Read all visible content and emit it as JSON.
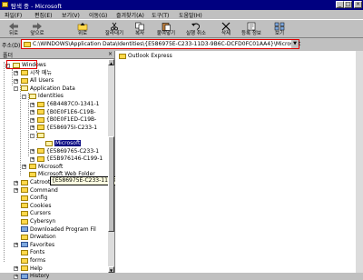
{
  "window": {
    "title": "탐색 중 - Microsoft",
    "buttons": {
      "minimize": "_",
      "maximize": "□",
      "close": "×"
    }
  },
  "menu": [
    "파일(F)",
    "편집(E)",
    "보기(V)",
    "이동(G)",
    "즐겨찾기(A)",
    "도구(T)",
    "도움말(H)"
  ],
  "toolbar": [
    {
      "label": "뒤로",
      "icon": "back-arrow-icon"
    },
    {
      "label": "앞으로",
      "icon": "forward-arrow-icon"
    },
    {
      "label": "위로",
      "icon": "up-folder-icon"
    },
    {
      "label": "잘라내기",
      "icon": "scissors-icon"
    },
    {
      "label": "복사",
      "icon": "copy-icon"
    },
    {
      "label": "붙여넣기",
      "icon": "paste-icon"
    },
    {
      "label": "실행 취소",
      "icon": "undo-icon"
    },
    {
      "label": "삭제",
      "icon": "delete-icon"
    },
    {
      "label": "등록 정보",
      "icon": "properties-icon"
    },
    {
      "label": "보기",
      "icon": "views-icon"
    }
  ],
  "address": {
    "label": "주소(D)",
    "value": "C:\\WINDOWS\\Application Data\\Identities\\{E586975E-C233-11D3-9B6C-DCFD0FC01AA4}\\Microsoft"
  },
  "tree": {
    "header": "폴더",
    "close": "×",
    "nodes": [
      {
        "label": "Windows",
        "level": 1,
        "pm": "-",
        "icon": "folder-open-icon",
        "highlight": true
      },
      {
        "label": "시작 메뉴",
        "level": 2,
        "pm": "+",
        "icon": "folder-icon"
      },
      {
        "label": "All Users",
        "level": 2,
        "pm": "+",
        "icon": "folder-icon"
      },
      {
        "label": "Application Data",
        "level": 2,
        "pm": "-",
        "icon": "folder-open-icon"
      },
      {
        "label": "Identities",
        "level": 3,
        "pm": "-",
        "icon": "folder-open-icon"
      },
      {
        "label": "{6B4487C0-1341-1",
        "level": 4,
        "pm": "+",
        "icon": "folder-icon"
      },
      {
        "label": "{B0E0F1E6-C19B-",
        "level": 4,
        "pm": "+",
        "icon": "folder-icon"
      },
      {
        "label": "{B0E0F1ED-C19B-",
        "level": 4,
        "pm": "+",
        "icon": "folder-icon"
      },
      {
        "label": "{E586975I-C233-1",
        "level": 4,
        "pm": "+",
        "icon": "folder-icon"
      },
      {
        "label": "{E586975E-C233-11D3-9B6C-DCFD0FC01AA4}",
        "level": 4,
        "pm": "-",
        "icon": "folder-open-icon",
        "tooltip": true
      },
      {
        "label": "Microsoft",
        "level": 5,
        "pm": "",
        "icon": "folder-open-icon",
        "selected": true
      },
      {
        "label": "{E5869765-C233-1",
        "level": 4,
        "pm": "+",
        "icon": "folder-icon"
      },
      {
        "label": "{E5B976146-C199-1",
        "level": 4,
        "pm": "+",
        "icon": "folder-icon"
      },
      {
        "label": "Microsoft",
        "level": 3,
        "pm": "+",
        "icon": "folder-icon"
      },
      {
        "label": "Microsoft Web Folder",
        "level": 3,
        "pm": "",
        "icon": "folder-icon"
      },
      {
        "label": "Catroot",
        "level": 2,
        "pm": "+",
        "icon": "folder-icon"
      },
      {
        "label": "Command",
        "level": 2,
        "pm": "+",
        "icon": "folder-icon"
      },
      {
        "label": "Config",
        "level": 2,
        "pm": "",
        "icon": "folder-icon"
      },
      {
        "label": "Cookies",
        "level": 2,
        "pm": "",
        "icon": "folder-icon"
      },
      {
        "label": "Cursors",
        "level": 2,
        "pm": "",
        "icon": "folder-icon"
      },
      {
        "label": "Cybersyn",
        "level": 2,
        "pm": "",
        "icon": "folder-icon"
      },
      {
        "label": "Downloaded Program Fil",
        "level": 2,
        "pm": "",
        "icon": "special-folder-icon"
      },
      {
        "label": "Drwatson",
        "level": 2,
        "pm": "",
        "icon": "folder-icon"
      },
      {
        "label": "Favorites",
        "level": 2,
        "pm": "+",
        "icon": "special-folder-icon"
      },
      {
        "label": "Fonts",
        "level": 2,
        "pm": "",
        "icon": "folder-icon"
      },
      {
        "label": "forms",
        "level": 2,
        "pm": "",
        "icon": "folder-icon"
      },
      {
        "label": "Help",
        "level": 2,
        "pm": "+",
        "icon": "folder-icon"
      },
      {
        "label": "History",
        "level": 2,
        "pm": "+",
        "icon": "special-folder-icon"
      }
    ]
  },
  "contents": [
    {
      "label": "Outlook Express",
      "icon": "folder-icon"
    }
  ]
}
